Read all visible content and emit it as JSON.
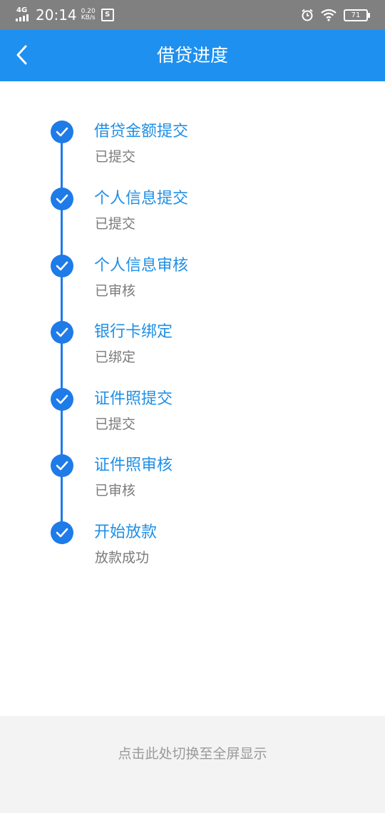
{
  "status_bar": {
    "network": "4G",
    "time": "20:14",
    "speed_value": "0.20",
    "speed_unit": "KB/s",
    "s_badge": "S",
    "battery": "71"
  },
  "header": {
    "title": "借贷进度"
  },
  "steps": [
    {
      "title": "借贷金额提交",
      "status": "已提交"
    },
    {
      "title": "个人信息提交",
      "status": "已提交"
    },
    {
      "title": "个人信息审核",
      "status": "已审核"
    },
    {
      "title": "银行卡绑定",
      "status": "已绑定"
    },
    {
      "title": "证件照提交",
      "status": "已提交"
    },
    {
      "title": "证件照审核",
      "status": "已审核"
    },
    {
      "title": "开始放款",
      "status": "放款成功"
    }
  ],
  "footer": {
    "fullscreen_hint": "点击此处切换至全屏显示"
  },
  "colors": {
    "primary": "#1e90f0",
    "check": "#1e7be8",
    "status_text": "#7a7a7a"
  }
}
